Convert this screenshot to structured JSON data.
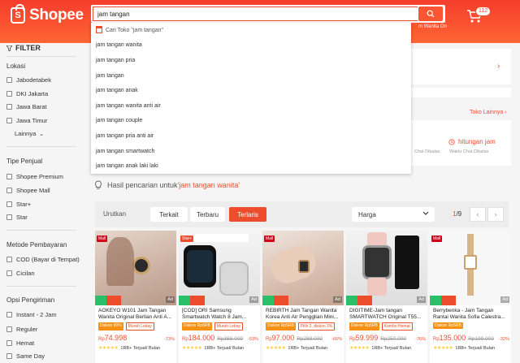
{
  "header": {
    "brand": "Shopee",
    "cart_count": "112",
    "hint": "m Wanita Ori"
  },
  "search": {
    "value": "jam tangan",
    "placeholder": ""
  },
  "suggestions": {
    "shop_item": "Cari Toko \"jam tangan\"",
    "items": [
      "jam tangan wanita",
      "jam tangan pria",
      "jam tangan",
      "jam tangan anak",
      "jam tangan wanita anti air",
      "jam tangan couple",
      "jam tangan pria anti air",
      "jam tangan smartwatch",
      "jam tangan anak laki laki"
    ]
  },
  "filter": {
    "title": "FILTER",
    "lokasi": {
      "title": "Lokasi",
      "items": [
        "Jabodetabek",
        "DKI Jakarta",
        "Jawa Barat",
        "Jawa Timur"
      ],
      "more": "Lainnya"
    },
    "tipe": {
      "title": "Tipe Penjual",
      "items": [
        "Shopee Premium",
        "Shopee Mall",
        "Star+",
        "Star"
      ]
    },
    "bayar": {
      "title": "Metode Pembayaran",
      "items": [
        "COD (Bayar di Tempat)",
        "Cicilan"
      ]
    },
    "kirim": {
      "title": "Opsi Pengiriman",
      "items": [
        "Instant - 2 Jam",
        "Reguler",
        "Hemat",
        "Same Day"
      ]
    }
  },
  "shop_section": {
    "toko_link": "Toko Lainnya",
    "chat_title": "hitungan jam",
    "chat_sub1": "Chat Dibalas",
    "chat_sub2": "Waktu Chat Dibalas"
  },
  "result": {
    "prefix": "Hasil pencarian untuk ",
    "keyword": "'jam tangan wanita'"
  },
  "sort": {
    "label": "Urutkan",
    "options": [
      "Terkait",
      "Terbaru",
      "Terlaris"
    ],
    "active": "Terlaris",
    "price_select": "Harga",
    "page_current": "1",
    "page_total": "/9"
  },
  "products": [
    {
      "name": "AOKEYO W101 Jam Tangan Wanita Original Berlian Anti A...",
      "badge1": "Diskon 90%",
      "badge2": "Murah Lebay",
      "price": "74.998",
      "old_price": "",
      "disc": "-73%",
      "sold": "1RB+ Terjual/ Bulan",
      "mall": true,
      "ad": true
    },
    {
      "name": "[COD] ORI Samsung Smartwatch Watch 8 Jam...",
      "badge1": "Diskon Rp5RB",
      "badge2": "Murah Lebay",
      "price": "184.000",
      "old_price": "Rp388.000",
      "disc": "-53%",
      "sold": "1RB+ Terjual/ Bulan",
      "mall": false,
      "ad": true
    },
    {
      "name": "REBIRTH Jam Tangan Wanita Korea Anti Air Pengglian Mini...",
      "badge1": "Diskon Rp5RB",
      "badge2": "Pilih 2, diskon 3%",
      "price": "97.000",
      "old_price": "Rp288.000",
      "disc": "-66%",
      "sold": "1RB+ Terjual/ Bulan",
      "mall": true,
      "ad": true
    },
    {
      "name": "DIGITIME-Jam tangan SMARTWATCH Original T55...",
      "badge1": "Diskon Rp5RB",
      "badge2": "Kombo Hemat",
      "price": "59.999",
      "old_price": "Rp250.000",
      "disc": "-76%",
      "sold": "1RB+ Terjual/ Bulan",
      "mall": false,
      "ad": true
    },
    {
      "name": "Berrybenka - Jam Tangan Rantai Wanita Sofia Calestra...",
      "badge1": "Diskon Rp5RB",
      "badge2": "",
      "price": "135.000",
      "old_price": "Rp199.000",
      "disc": "-32%",
      "sold": "1RB+ Terjual/ Bulan",
      "mall": true,
      "ad": true
    }
  ],
  "colors": {
    "brand": "#ee4d2d",
    "header_start": "#f53d2d",
    "header_end": "#ff6633",
    "star": "#ffce3d",
    "promo_green": "#2bbf6a"
  }
}
